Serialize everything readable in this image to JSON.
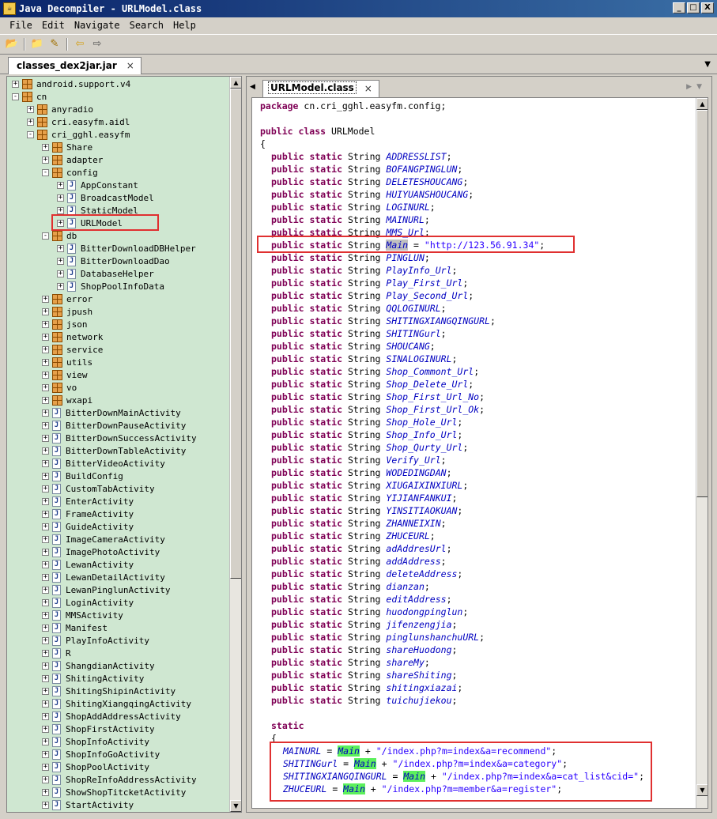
{
  "window": {
    "title": "Java Decompiler - URLModel.class",
    "icon": "java-decompiler-icon",
    "buttons": {
      "minimize": "_",
      "maximize": "□",
      "close": "X"
    }
  },
  "menu": [
    "File",
    "Edit",
    "Navigate",
    "Search",
    "Help"
  ],
  "toolbar_icons": [
    "open-folder-icon",
    "open-file-icon",
    "settings-icon",
    "back-arrow-icon",
    "forward-arrow-icon"
  ],
  "jar_tab": {
    "label": "classes_dex2jar.jar",
    "close": "×"
  },
  "class_tab": {
    "label": "URLModel.class",
    "close": "×"
  },
  "tree": [
    {
      "indent": 0,
      "expander": "+",
      "icon": "package",
      "label": "android.support.v4"
    },
    {
      "indent": 0,
      "expander": "-",
      "icon": "package",
      "label": "cn"
    },
    {
      "indent": 1,
      "expander": "+",
      "icon": "package",
      "label": "anyradio"
    },
    {
      "indent": 1,
      "expander": "+",
      "icon": "package",
      "label": "cri.easyfm.aidl"
    },
    {
      "indent": 1,
      "expander": "-",
      "icon": "package",
      "label": "cri_gghl.easyfm"
    },
    {
      "indent": 2,
      "expander": "+",
      "icon": "package",
      "label": "Share"
    },
    {
      "indent": 2,
      "expander": "+",
      "icon": "package",
      "label": "adapter"
    },
    {
      "indent": 2,
      "expander": "-",
      "icon": "package",
      "label": "config"
    },
    {
      "indent": 3,
      "expander": "+",
      "icon": "java",
      "label": "AppConstant"
    },
    {
      "indent": 3,
      "expander": "+",
      "icon": "java",
      "label": "BroadcastModel"
    },
    {
      "indent": 3,
      "expander": "+",
      "icon": "java",
      "label": "StaticModel"
    },
    {
      "indent": 3,
      "expander": "+",
      "icon": "java",
      "label": "URLModel"
    },
    {
      "indent": 2,
      "expander": "-",
      "icon": "package",
      "label": "db"
    },
    {
      "indent": 3,
      "expander": "+",
      "icon": "java",
      "label": "BitterDownloadDBHelper"
    },
    {
      "indent": 3,
      "expander": "+",
      "icon": "java",
      "label": "BitterDownloadDao"
    },
    {
      "indent": 3,
      "expander": "+",
      "icon": "java",
      "label": "DatabaseHelper"
    },
    {
      "indent": 3,
      "expander": "+",
      "icon": "java",
      "label": "ShopPoolInfoData"
    },
    {
      "indent": 2,
      "expander": "+",
      "icon": "package",
      "label": "error"
    },
    {
      "indent": 2,
      "expander": "+",
      "icon": "package",
      "label": "jpush"
    },
    {
      "indent": 2,
      "expander": "+",
      "icon": "package",
      "label": "json"
    },
    {
      "indent": 2,
      "expander": "+",
      "icon": "package",
      "label": "network"
    },
    {
      "indent": 2,
      "expander": "+",
      "icon": "package",
      "label": "service"
    },
    {
      "indent": 2,
      "expander": "+",
      "icon": "package",
      "label": "utils"
    },
    {
      "indent": 2,
      "expander": "+",
      "icon": "package",
      "label": "view"
    },
    {
      "indent": 2,
      "expander": "+",
      "icon": "package",
      "label": "vo"
    },
    {
      "indent": 2,
      "expander": "+",
      "icon": "package",
      "label": "wxapi"
    },
    {
      "indent": 2,
      "expander": "+",
      "icon": "java",
      "label": "BitterDownMainActivity"
    },
    {
      "indent": 2,
      "expander": "+",
      "icon": "java",
      "label": "BitterDownPauseActivity"
    },
    {
      "indent": 2,
      "expander": "+",
      "icon": "java",
      "label": "BitterDownSuccessActivity"
    },
    {
      "indent": 2,
      "expander": "+",
      "icon": "java",
      "label": "BitterDownTableActivity"
    },
    {
      "indent": 2,
      "expander": "+",
      "icon": "java",
      "label": "BitterVideoActivity"
    },
    {
      "indent": 2,
      "expander": "+",
      "icon": "java",
      "label": "BuildConfig"
    },
    {
      "indent": 2,
      "expander": "+",
      "icon": "java",
      "label": "CustomTabActivity"
    },
    {
      "indent": 2,
      "expander": "+",
      "icon": "java",
      "label": "EnterActivity"
    },
    {
      "indent": 2,
      "expander": "+",
      "icon": "java",
      "label": "FrameActivity"
    },
    {
      "indent": 2,
      "expander": "+",
      "icon": "java",
      "label": "GuideActivity"
    },
    {
      "indent": 2,
      "expander": "+",
      "icon": "java",
      "label": "ImageCameraActivity"
    },
    {
      "indent": 2,
      "expander": "+",
      "icon": "java",
      "label": "ImagePhotoActivity"
    },
    {
      "indent": 2,
      "expander": "+",
      "icon": "java",
      "label": "LewanActivity"
    },
    {
      "indent": 2,
      "expander": "+",
      "icon": "java",
      "label": "LewanDetailActivity"
    },
    {
      "indent": 2,
      "expander": "+",
      "icon": "java",
      "label": "LewanPinglunActivity"
    },
    {
      "indent": 2,
      "expander": "+",
      "icon": "java",
      "label": "LoginActivity"
    },
    {
      "indent": 2,
      "expander": "+",
      "icon": "java",
      "label": "MMSActivity"
    },
    {
      "indent": 2,
      "expander": "+",
      "icon": "java",
      "label": "Manifest"
    },
    {
      "indent": 2,
      "expander": "+",
      "icon": "java",
      "label": "PlayInfoActivity"
    },
    {
      "indent": 2,
      "expander": "+",
      "icon": "java",
      "label": "R"
    },
    {
      "indent": 2,
      "expander": "+",
      "icon": "java",
      "label": "ShangdianActivity"
    },
    {
      "indent": 2,
      "expander": "+",
      "icon": "java",
      "label": "ShitingActivity"
    },
    {
      "indent": 2,
      "expander": "+",
      "icon": "java",
      "label": "ShitingShipinActivity"
    },
    {
      "indent": 2,
      "expander": "+",
      "icon": "java",
      "label": "ShitingXiangqingActivity"
    },
    {
      "indent": 2,
      "expander": "+",
      "icon": "java",
      "label": "ShopAddAddressActivity"
    },
    {
      "indent": 2,
      "expander": "+",
      "icon": "java",
      "label": "ShopFirstActivity"
    },
    {
      "indent": 2,
      "expander": "+",
      "icon": "java",
      "label": "ShopInfoActivity"
    },
    {
      "indent": 2,
      "expander": "+",
      "icon": "java",
      "label": "ShopInfoGoActivity"
    },
    {
      "indent": 2,
      "expander": "+",
      "icon": "java",
      "label": "ShopPoolActivity"
    },
    {
      "indent": 2,
      "expander": "+",
      "icon": "java",
      "label": "ShopReInfoAddressActivity"
    },
    {
      "indent": 2,
      "expander": "+",
      "icon": "java",
      "label": "ShowShopTitcketActivity"
    },
    {
      "indent": 2,
      "expander": "+",
      "icon": "java",
      "label": "StartActivity"
    }
  ],
  "code": {
    "package_line": "package cn.cri_gghl.easyfm.config;",
    "class_line": "public class URLModel",
    "open_brace": "{",
    "modifiers": "public static String",
    "fields": [
      "ADDRESSLIST",
      "BOFANGPINGLUN",
      "DELETESHOUCANG",
      "HUIYUANSHOUCANG",
      "LOGINURL",
      "MAINURL",
      "MMS_Url",
      "Main",
      "PINGLUN",
      "PlayInfo_Url",
      "Play_First_Url",
      "Play_Second_Url",
      "QQLOGINURL",
      "SHITINGXIANGQINGURL",
      "SHITINGurl",
      "SHOUCANG",
      "SINALOGINURL",
      "Shop_Commont_Url",
      "Shop_Delete_Url",
      "Shop_First_Url_No",
      "Shop_First_Url_Ok",
      "Shop_Hole_Url",
      "Shop_Info_Url",
      "Shop_Qurty_Url",
      "Verify_Url",
      "WODEDINGDAN",
      "XIUGAIXINXIURL",
      "YIJIANFANKUI",
      "YINSITIAOKUAN",
      "ZHANNEIXIN",
      "ZHUCEURL",
      "adAddresUrl",
      "addAddress",
      "deleteAddress",
      "dianzan",
      "editAddress",
      "huodongpinglun",
      "jifenzengjia",
      "pinglunshanchuURL",
      "shareHuodong",
      "shareMy",
      "shareShiting",
      "shitingxiazai",
      "tuichujiekou"
    ],
    "main_value": "\"http://123.56.91.34\"",
    "static_kw": "static",
    "static_brace": "{",
    "static_lines": [
      {
        "field": "MAINURL",
        "ref": "Main",
        "str": "\"/index.php?m=index&a=recommend\""
      },
      {
        "field": "SHITINGurl",
        "ref": "Main",
        "str": "\"/index.php?m=index&a=category\""
      },
      {
        "field": "SHITINGXIANGQINGURL",
        "ref": "Main",
        "str": "\"/index.php?m=index&a=cat_list&cid=\""
      },
      {
        "field": "ZHUCEURL",
        "ref": "Main",
        "str": "\"/index.php?m=member&a=register\""
      }
    ]
  },
  "colors": {
    "tree_bg": "#cfe7d1",
    "keyword": "#7f0055",
    "field": "#0000c0",
    "string": "#2a00ff",
    "highlight_box": "#e03030",
    "main_ref_highlight": "#5cf05c"
  }
}
